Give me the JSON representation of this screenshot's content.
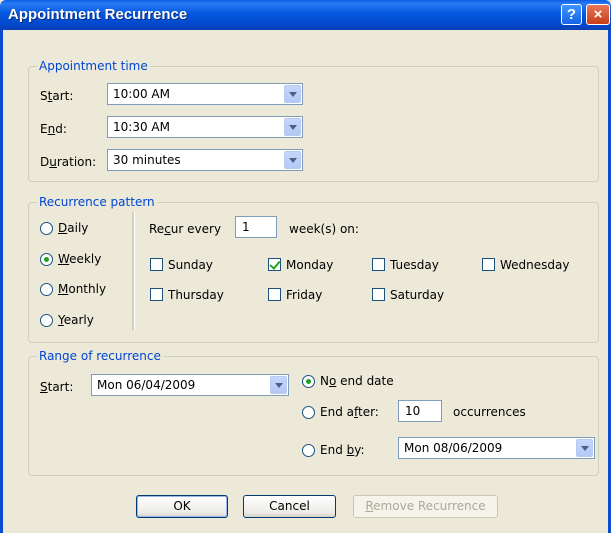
{
  "window": {
    "title": "Appointment Recurrence",
    "help_icon": "?",
    "close_icon": "×"
  },
  "appointment_time": {
    "legend": "Appointment time",
    "start": {
      "prefix": "S",
      "accel": "t",
      "suffix": "art:",
      "value": "10:00 AM"
    },
    "end": {
      "prefix": "E",
      "accel": "n",
      "suffix": "d:",
      "value": "10:30 AM"
    },
    "duration": {
      "prefix": "D",
      "accel": "u",
      "suffix": "ration:",
      "value": "30 minutes"
    }
  },
  "recurrence_pattern": {
    "legend": "Recurrence pattern",
    "types": [
      {
        "accel": "D",
        "rest": "aily",
        "selected": false
      },
      {
        "accel": "W",
        "rest": "eekly",
        "selected": true
      },
      {
        "accel": "M",
        "rest": "onthly",
        "selected": false
      },
      {
        "accel": "Y",
        "rest": "early",
        "selected": false
      }
    ],
    "recur_every": {
      "prefix": "Re",
      "accel": "c",
      "suffix": "ur every",
      "value": "1",
      "unit": "week(s) on:"
    },
    "days": [
      {
        "label": "Sunday",
        "checked": false
      },
      {
        "label": "Monday",
        "checked": true
      },
      {
        "label": "Tuesday",
        "checked": false
      },
      {
        "label": "Wednesday",
        "checked": false
      },
      {
        "label": "Thursday",
        "checked": false
      },
      {
        "label": "Friday",
        "checked": false
      },
      {
        "label": "Saturday",
        "checked": false
      }
    ]
  },
  "range": {
    "legend": "Range of recurrence",
    "start": {
      "prefix": "",
      "accel": "S",
      "suffix": "tart:",
      "value": "Mon 06/04/2009"
    },
    "no_end": {
      "prefix": "N",
      "accel": "o",
      "suffix": " end date",
      "selected": true
    },
    "end_after": {
      "prefix": "End a",
      "accel": "f",
      "suffix": "ter:",
      "value": "10",
      "unit": "occurrences",
      "selected": false
    },
    "end_by": {
      "prefix": "End ",
      "accel": "b",
      "suffix": "y:",
      "value": "Mon 08/06/2009",
      "selected": false
    }
  },
  "buttons": {
    "ok": "OK",
    "cancel": "Cancel",
    "remove": {
      "accel": "R",
      "rest": "emove Recurrence",
      "enabled": false
    }
  }
}
